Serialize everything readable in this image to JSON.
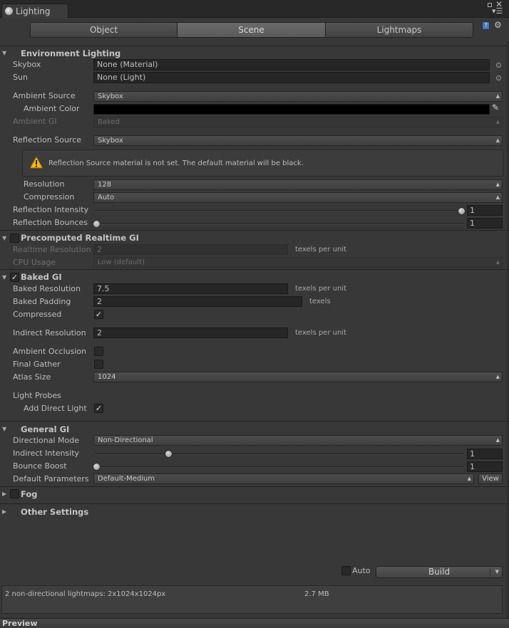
{
  "window": {
    "tab_title": "Lighting"
  },
  "tabs": [
    {
      "label": "Object"
    },
    {
      "label": "Scene"
    },
    {
      "label": "Lightmaps"
    }
  ],
  "environment": {
    "title": "Environment Lighting",
    "skybox_label": "Skybox",
    "skybox_value": "None (Material)",
    "sun_label": "Sun",
    "sun_value": "None (Light)",
    "ambient_source_label": "Ambient Source",
    "ambient_source_value": "Skybox",
    "ambient_color_label": "Ambient Color",
    "ambient_color": "#000000",
    "ambient_gi_label": "Ambient GI",
    "ambient_gi_value": "Baked",
    "reflection_source_label": "Reflection Source",
    "reflection_source_value": "Skybox",
    "warning_text": "Reflection Source material is not set. The default material will be black.",
    "resolution_label": "Resolution",
    "resolution_value": "128",
    "compression_label": "Compression",
    "compression_value": "Auto",
    "reflection_intensity_label": "Reflection Intensity",
    "reflection_intensity_value": "1",
    "reflection_bounces_label": "Reflection Bounces",
    "reflection_bounces_value": "1"
  },
  "realtime_gi": {
    "title": "Precomputed Realtime GI",
    "enabled": false,
    "resolution_label": "Realtime Resolution",
    "resolution_value": "2",
    "resolution_unit": "texels per unit",
    "cpu_label": "CPU Usage",
    "cpu_value": "Low (default)"
  },
  "baked_gi": {
    "title": "Baked GI",
    "enabled": true,
    "baked_resolution_label": "Baked Resolution",
    "baked_resolution_value": "7.5",
    "baked_resolution_unit": "texels per unit",
    "baked_padding_label": "Baked Padding",
    "baked_padding_value": "2",
    "baked_padding_unit": "texels",
    "compressed_label": "Compressed",
    "compressed": true,
    "indirect_resolution_label": "Indirect Resolution",
    "indirect_resolution_value": "2",
    "indirect_resolution_unit": "texels per unit",
    "ambient_occlusion_label": "Ambient Occlusion",
    "ambient_occlusion": false,
    "final_gather_label": "Final Gather",
    "final_gather": false,
    "atlas_size_label": "Atlas Size",
    "atlas_size_value": "1024",
    "light_probes_label": "Light Probes",
    "add_direct_light_label": "Add Direct Light",
    "add_direct_light": true
  },
  "general_gi": {
    "title": "General GI",
    "directional_mode_label": "Directional Mode",
    "directional_mode_value": "Non-Directional",
    "indirect_intensity_label": "Indirect Intensity",
    "indirect_intensity_value": "1",
    "bounce_boost_label": "Bounce Boost",
    "bounce_boost_value": "1",
    "default_parameters_label": "Default Parameters",
    "default_parameters_value": "Default-Medium",
    "view_label": "View"
  },
  "fog": {
    "title": "Fog",
    "enabled": false
  },
  "other_settings": {
    "title": "Other Settings"
  },
  "build_bar": {
    "auto_label": "Auto",
    "auto_checked": false,
    "build_label": "Build"
  },
  "info": {
    "lightmaps_text": "2 non-directional lightmaps: 2x1024x1024px",
    "size_text": "2.7 MB"
  },
  "preview": {
    "title": "Preview"
  }
}
